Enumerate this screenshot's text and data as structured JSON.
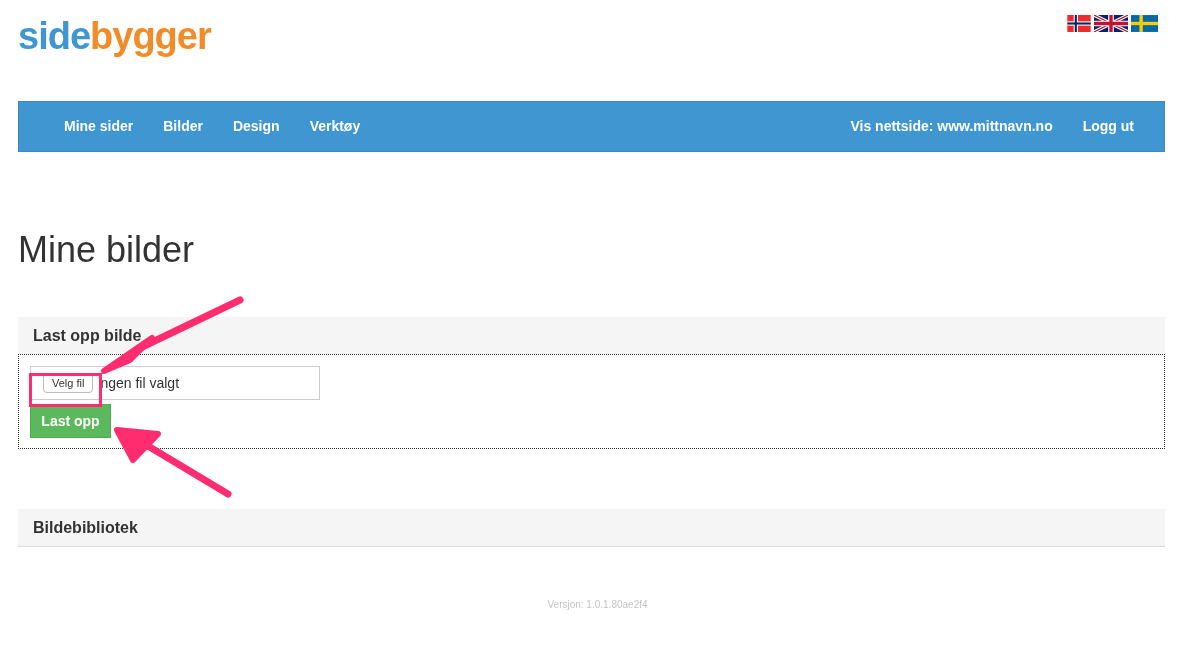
{
  "logo": {
    "first_part": "side",
    "second_part": "bygger"
  },
  "nav": {
    "left_items": [
      "Mine sider",
      "Bilder",
      "Design",
      "Verktøy"
    ],
    "right_items": [
      "Vis nettside: www.mittnavn.no",
      "Logg ut"
    ]
  },
  "page_title": "Mine bilder",
  "upload_panel": {
    "title": "Last opp bilde",
    "file_button": "Velg fil",
    "file_status": "ngen fil valgt",
    "submit_button": "Last opp"
  },
  "library_panel": {
    "title": "Bildebibliotek"
  },
  "footer": {
    "version": "Versjon: 1.0.1.80ae2f4"
  }
}
